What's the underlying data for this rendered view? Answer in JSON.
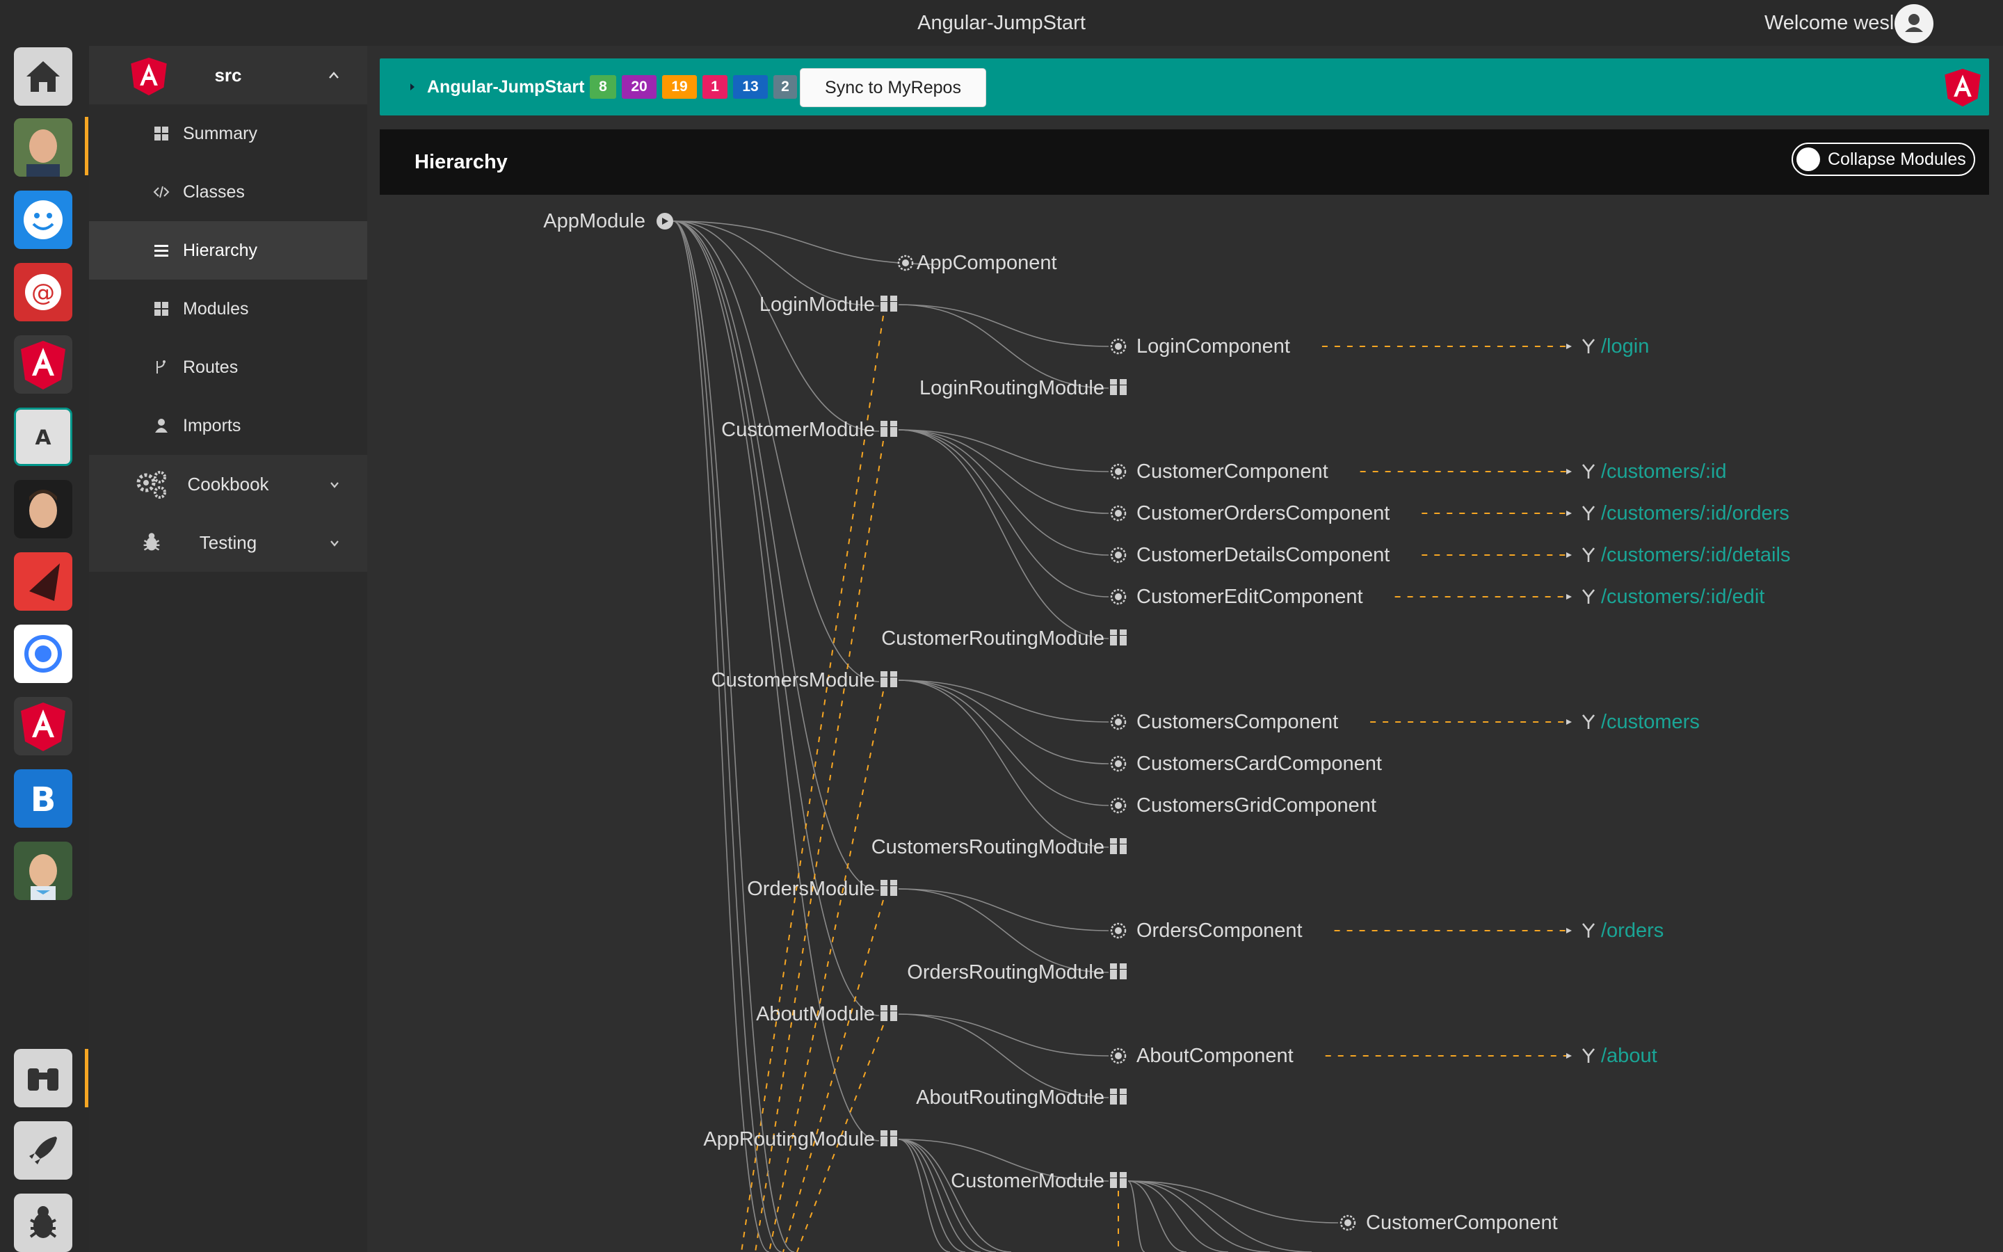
{
  "window": {
    "title": "Angular-JumpStart",
    "welcome": "Welcome wesley"
  },
  "dock": {
    "items": [
      "home-icon",
      "user-avatar-1",
      "happy-face-icon",
      "at-sign-icon",
      "angular-icon",
      "a-icon",
      "user-avatar-2",
      "triangle-icon",
      "ring-icon",
      "angular-icon",
      "bootstrap-icon",
      "user-avatar-3",
      "binoculars-icon",
      "rocket-icon",
      "bug-icon"
    ]
  },
  "sidebar": {
    "project": "src",
    "items": [
      {
        "label": "Summary",
        "icon": "grid-icon"
      },
      {
        "label": "Classes",
        "icon": "code-icon"
      },
      {
        "label": "Hierarchy",
        "icon": "list-icon"
      },
      {
        "label": "Modules",
        "icon": "grid-icon"
      },
      {
        "label": "Routes",
        "icon": "branch-icon"
      },
      {
        "label": "Imports",
        "icon": "person-icon"
      }
    ],
    "groups": [
      {
        "label": "Cookbook",
        "icon": "gears-icon"
      },
      {
        "label": "Testing",
        "icon": "bug-icon"
      }
    ]
  },
  "repo": {
    "name": "Angular-JumpStart",
    "badges": [
      {
        "value": "8",
        "color": "#4caf50"
      },
      {
        "value": "20",
        "color": "#9c27b0"
      },
      {
        "value": "19",
        "color": "#ff9800"
      },
      {
        "value": "1",
        "color": "#e91e63"
      },
      {
        "value": "13",
        "color": "#1565c0"
      },
      {
        "value": "2",
        "color": "#607d8b"
      }
    ],
    "sync_label": "Sync to MyRepos"
  },
  "hierarchy": {
    "title": "Hierarchy",
    "collapse_label": "Collapse Modules",
    "root": "AppModule",
    "modules": [
      {
        "name": "LoginModule",
        "components": [
          {
            "name": "LoginComponent",
            "route": "/login"
          }
        ],
        "routing": "LoginRoutingModule"
      },
      {
        "name": "CustomerModule",
        "components": [
          {
            "name": "CustomerComponent",
            "route": "/customers/:id"
          },
          {
            "name": "CustomerOrdersComponent",
            "route": "/customers/:id/orders"
          },
          {
            "name": "CustomerDetailsComponent",
            "route": "/customers/:id/details"
          },
          {
            "name": "CustomerEditComponent",
            "route": "/customers/:id/edit"
          }
        ],
        "routing": "CustomerRoutingModule"
      },
      {
        "name": "CustomersModule",
        "components": [
          {
            "name": "CustomersComponent",
            "route": "/customers"
          },
          {
            "name": "CustomersCardComponent",
            "route": ""
          },
          {
            "name": "CustomersGridComponent",
            "route": ""
          }
        ],
        "routing": "CustomersRoutingModule"
      },
      {
        "name": "OrdersModule",
        "components": [
          {
            "name": "OrdersComponent",
            "route": "/orders"
          }
        ],
        "routing": "OrdersRoutingModule"
      },
      {
        "name": "AboutModule",
        "components": [
          {
            "name": "AboutComponent",
            "route": "/about"
          }
        ],
        "routing": "AboutRoutingModule"
      }
    ],
    "app_component": "AppComponent",
    "app_routing": {
      "name": "AppRoutingModule",
      "child_module": "CustomerModule",
      "child_component": "CustomerComponent"
    }
  },
  "colors": {
    "teal": "#00968a",
    "route": "#1aa596",
    "dashed": "#f6a623",
    "link": "#8a8a8a"
  }
}
